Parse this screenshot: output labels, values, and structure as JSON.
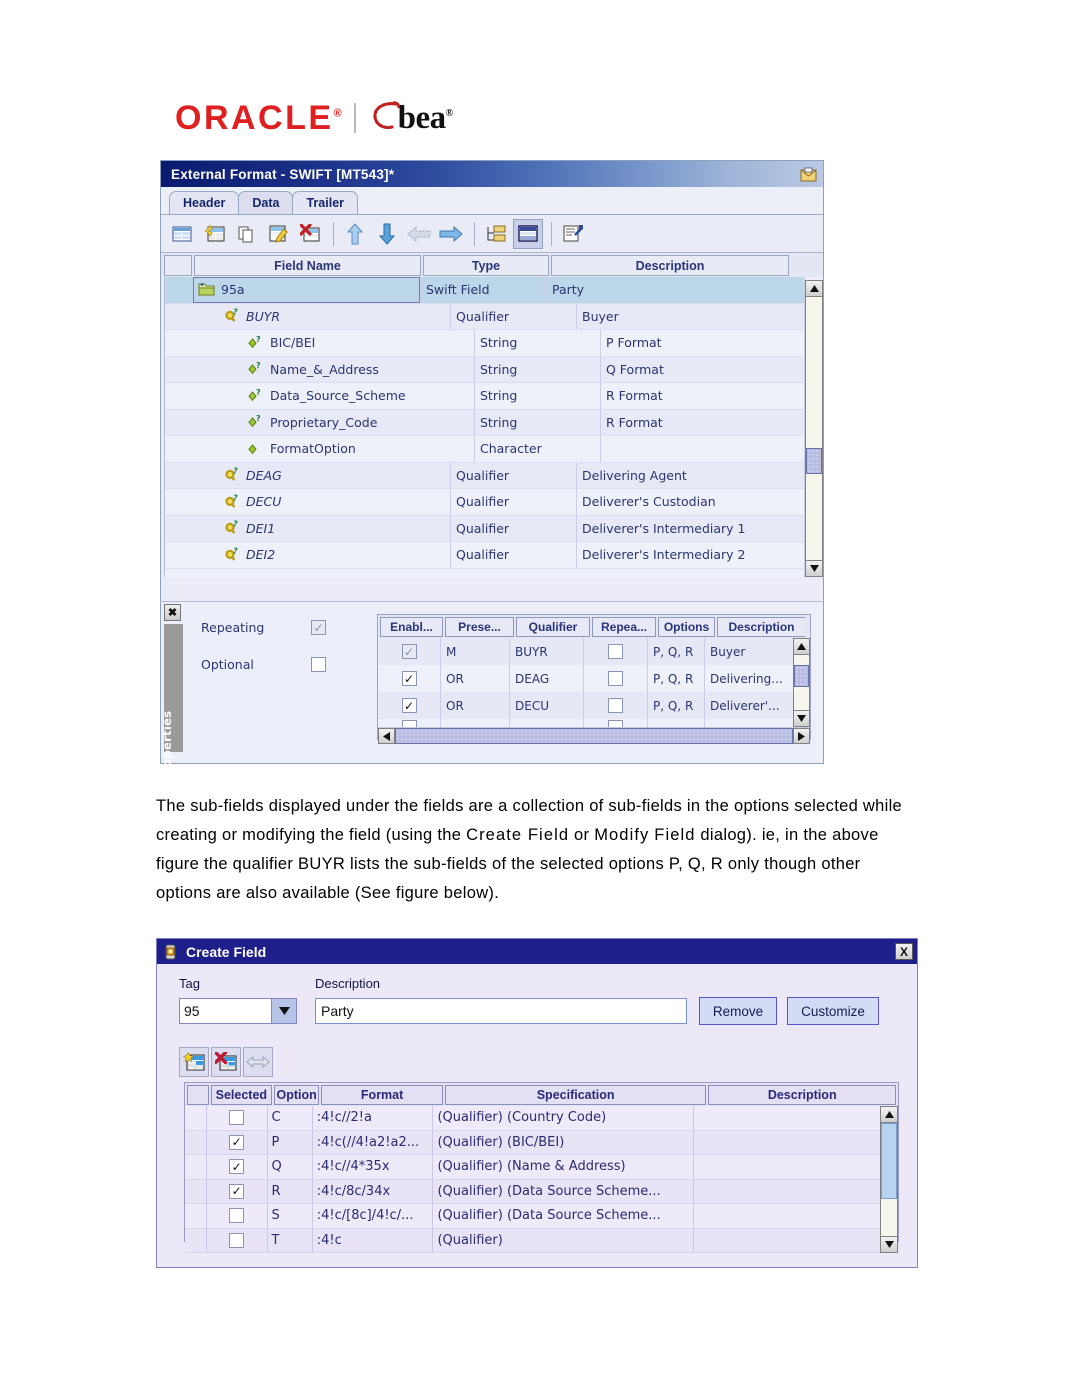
{
  "logo": {
    "oracle": "ORACLE",
    "registered": "®",
    "separator": "|",
    "bea": "bea",
    "bea_registered": "®"
  },
  "window1": {
    "title": "External Format - SWIFT [MT543]*",
    "title_icon": "mail-envelope-icon",
    "tabs": [
      {
        "label": "Header",
        "active": false
      },
      {
        "label": "Data",
        "active": true
      },
      {
        "label": "Trailer",
        "active": false
      }
    ],
    "toolbar": [
      {
        "name": "new-format-icon",
        "selected": false
      },
      {
        "name": "add-field-icon",
        "selected": false
      },
      {
        "name": "copy-icon",
        "selected": false
      },
      {
        "name": "edit-field-icon",
        "selected": false
      },
      {
        "name": "delete-field-icon",
        "selected": false
      },
      {
        "name": "move-up-icon",
        "selected": false
      },
      {
        "name": "move-down-icon",
        "selected": false
      },
      {
        "name": "move-left-icon",
        "selected": false
      },
      {
        "name": "move-right-icon",
        "selected": false
      },
      {
        "name": "tree-expand-icon",
        "selected": false
      },
      {
        "name": "properties-panel-icon",
        "selected": true
      },
      {
        "name": "document-properties-icon",
        "selected": false
      }
    ],
    "grid_headers": [
      "",
      "Field Name",
      "Type",
      "Description"
    ],
    "rows": [
      {
        "name": "95a",
        "type": "Swift Field",
        "desc": "Party",
        "indent": 0,
        "icon": "folder-field-icon",
        "italic": false,
        "selected": true
      },
      {
        "name": "BUYR",
        "type": "Qualifier",
        "desc": "Buyer",
        "indent": 1,
        "icon": "qualifier-icon",
        "italic": true,
        "selected": false
      },
      {
        "name": "BIC/BEI",
        "type": "String",
        "desc": "P Format",
        "indent": 2,
        "icon": "subfield-optional-icon",
        "italic": false,
        "selected": false
      },
      {
        "name": "Name_&_Address",
        "type": "String",
        "desc": "Q Format",
        "indent": 2,
        "icon": "subfield-optional-icon",
        "italic": false,
        "selected": false
      },
      {
        "name": "Data_Source_Scheme",
        "type": "String",
        "desc": "R Format",
        "indent": 2,
        "icon": "subfield-optional-icon",
        "italic": false,
        "selected": false
      },
      {
        "name": "Proprietary_Code",
        "type": "String",
        "desc": "R Format",
        "indent": 2,
        "icon": "subfield-optional-icon",
        "italic": false,
        "selected": false
      },
      {
        "name": "FormatOption",
        "type": "Character",
        "desc": "",
        "indent": 2,
        "icon": "subfield-icon",
        "italic": false,
        "selected": false
      },
      {
        "name": "DEAG",
        "type": "Qualifier",
        "desc": "Delivering Agent",
        "indent": 1,
        "icon": "qualifier-icon",
        "italic": true,
        "selected": false
      },
      {
        "name": "DECU",
        "type": "Qualifier",
        "desc": "Deliverer's Custodian",
        "indent": 1,
        "icon": "qualifier-icon",
        "italic": true,
        "selected": false
      },
      {
        "name": "DEI1",
        "type": "Qualifier",
        "desc": "Deliverer's Intermediary 1",
        "indent": 1,
        "icon": "qualifier-icon",
        "italic": true,
        "selected": false
      },
      {
        "name": "DEI2",
        "type": "Qualifier",
        "desc": "Deliverer's Intermediary 2",
        "indent": 1,
        "icon": "qualifier-icon",
        "italic": true,
        "selected": false
      }
    ],
    "properties": {
      "panel_label": "Properties",
      "close_label": "✖",
      "checks": [
        {
          "label": "Repeating",
          "checked": true,
          "disabled": true
        },
        {
          "label": "Optional",
          "checked": false,
          "disabled": false
        }
      ],
      "grid_headers": [
        "Enabl...",
        "Prese...",
        "Qualifier",
        "Repea...",
        "Options",
        "Description"
      ],
      "grid_rows": [
        {
          "enabled": true,
          "enabled_disabled": true,
          "presence": "M",
          "qualifier": "BUYR",
          "repeating": false,
          "options": "P, Q, R",
          "description": "Buyer"
        },
        {
          "enabled": true,
          "enabled_disabled": false,
          "presence": "OR",
          "qualifier": "DEAG",
          "repeating": false,
          "options": "P, Q, R",
          "description": "Delivering..."
        },
        {
          "enabled": true,
          "enabled_disabled": false,
          "presence": "OR",
          "qualifier": "DECU",
          "repeating": false,
          "options": "P, Q, R",
          "description": "Deliverer'..."
        }
      ]
    }
  },
  "paragraph": {
    "line1": "The sub-fields displayed under the fields are a collection of sub-fields in the options",
    "line2a": "selected while creating or modifying the field (using the ",
    "line2b": "Create Field",
    "line2c": " or ",
    "line2d": "Modify",
    "line3a": "Field",
    "line3b": " dialog). ie, in the above figure the qualifier BUYR lists the sub-fields of the",
    "line4": "selected options P, Q, R only though other options are also available (See figure",
    "line5": "below)."
  },
  "window2": {
    "title": "Create Field",
    "title_icon": "create-field-icon",
    "close_label": "X",
    "tag_label": "Tag",
    "tag_value": "95",
    "description_label": "Description",
    "description_value": "Party",
    "remove_label": "Remove",
    "customize_label": "Customize",
    "toolbar": [
      {
        "name": "add-option-icon"
      },
      {
        "name": "delete-option-icon"
      },
      {
        "name": "resize-columns-icon"
      }
    ],
    "grid_headers": [
      "",
      "Selected",
      "Option",
      "Format",
      "Specification",
      "Description"
    ],
    "grid_rows": [
      {
        "selected": false,
        "option": "C",
        "format": ":4!c//2!a",
        "specification": "(Qualifier) (Country Code)",
        "description": ""
      },
      {
        "selected": true,
        "option": "P",
        "format": ":4!c(//4!a2!a2...",
        "specification": "(Qualifier) (BIC/BEI)",
        "description": ""
      },
      {
        "selected": true,
        "option": "Q",
        "format": ":4!c//4*35x",
        "specification": " (Qualifier) (Name & Address)",
        "description": ""
      },
      {
        "selected": true,
        "option": "R",
        "format": ":4!c/8c/34x",
        "specification": "(Qualifier) (Data Source Scheme...",
        "description": ""
      },
      {
        "selected": false,
        "option": "S",
        "format": ":4!c/[8c]/4!c/...",
        "specification": "(Qualifier) (Data Source Scheme...",
        "description": ""
      },
      {
        "selected": false,
        "option": "T",
        "format": ":4!c",
        "specification": "(Qualifier)",
        "description": ""
      }
    ]
  },
  "colors": {
    "title_blue": "#0a1a6e",
    "dialog_blue": "#1f1f8c",
    "oracle_red": "#e02020",
    "selection_blue": "#bcd6ea",
    "panel_lavender": "#eceef8",
    "header_text": "#2a3578"
  }
}
